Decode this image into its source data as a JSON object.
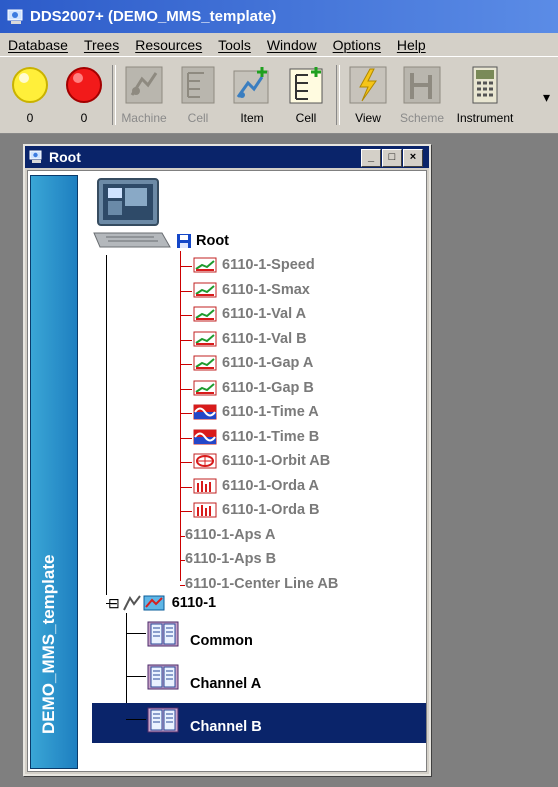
{
  "app": {
    "title": "DDS2007+ (DEMO_MMS_template)"
  },
  "menu": [
    "Database",
    "Trees",
    "Resources",
    "Tools",
    "Window",
    "Options",
    "Help"
  ],
  "toolbar": {
    "buttons": [
      {
        "label": "0",
        "icon": "yellow-circle-icon",
        "enabled": true
      },
      {
        "label": "0",
        "icon": "red-circle-icon",
        "enabled": true
      },
      {
        "label": "Machine",
        "icon": "machine-icon",
        "enabled": false
      },
      {
        "label": "Cell",
        "icon": "cell-icon",
        "enabled": false
      },
      {
        "label": "Item",
        "icon": "item-add-icon",
        "enabled": true
      },
      {
        "label": "Cell",
        "icon": "cell-add-icon",
        "enabled": true
      },
      {
        "label": "View",
        "icon": "lightning-icon",
        "enabled": true
      },
      {
        "label": "Scheme",
        "icon": "scheme-icon",
        "enabled": false
      },
      {
        "label": "Instrument",
        "icon": "instrument-icon",
        "enabled": true
      }
    ]
  },
  "window": {
    "title": "Root",
    "buttons": [
      "_",
      "□",
      "×"
    ],
    "side_label": "DEMO_MMS_template"
  },
  "tree": {
    "root_label": "Root",
    "leaves": [
      {
        "label": "6110-1-Speed",
        "icon": "trend-icon"
      },
      {
        "label": "6110-1-Smax",
        "icon": "trend-icon"
      },
      {
        "label": "6110-1-Val A",
        "icon": "trend-icon"
      },
      {
        "label": "6110-1-Val B",
        "icon": "trend-icon"
      },
      {
        "label": "6110-1-Gap A",
        "icon": "trend-icon"
      },
      {
        "label": "6110-1-Gap B",
        "icon": "trend-icon"
      },
      {
        "label": "6110-1-Time A",
        "icon": "waveform-icon"
      },
      {
        "label": "6110-1-Time B",
        "icon": "waveform-icon"
      },
      {
        "label": "6110-1-Orbit AB",
        "icon": "orbit-icon"
      },
      {
        "label": "6110-1-Orda A",
        "icon": "spectrum-icon"
      },
      {
        "label": "6110-1-Orda B",
        "icon": "spectrum-icon"
      },
      {
        "label": "6110-1-Aps A",
        "icon": ""
      },
      {
        "label": "6110-1-Aps B",
        "icon": ""
      },
      {
        "label": "6110-1-Center Line AB",
        "icon": ""
      }
    ],
    "machine_label": "6110-1",
    "collapse_glyph": "⊟",
    "cells": [
      {
        "label": "Common",
        "selected": false
      },
      {
        "label": "Channel A",
        "selected": false
      },
      {
        "label": "Channel B",
        "selected": true
      }
    ]
  },
  "colors": {
    "selection": "#0a246a",
    "title_bar": "#0a246a",
    "tree_connector": "#cc0000",
    "leaf_text": "#7a7a7a"
  }
}
